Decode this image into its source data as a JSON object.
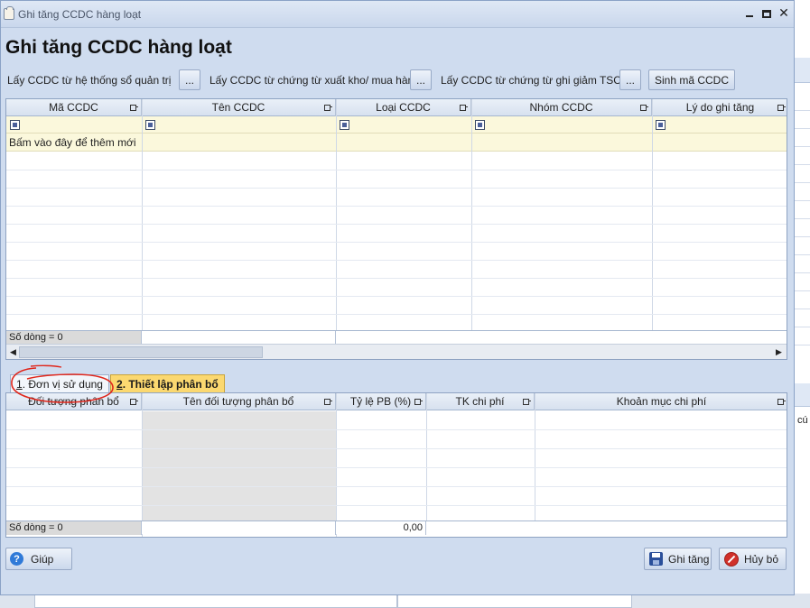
{
  "window": {
    "title": "Ghi tăng CCDC hàng loạt",
    "close_glyph": "✕"
  },
  "heading": "Ghi tăng CCDC hàng loạt",
  "toolbar": {
    "label1": "Lấy CCDC từ hệ thống sổ quản trị",
    "label2": "Lấy CCDC từ chứng từ xuất kho/ mua hàng",
    "label3": "Lấy CCDC từ chứng từ ghi giảm TSCĐ",
    "ellipsis": "...",
    "generate_code": "Sinh mã CCDC"
  },
  "top_grid": {
    "columns": [
      "Mã CCDC",
      "Tên CCDC",
      "Loại CCDC",
      "Nhóm CCDC",
      "Lý do ghi tăng"
    ],
    "new_row_text": "Bấm vào đây để thêm mới",
    "row_count": "Số dòng = 0"
  },
  "tabs": [
    {
      "num": "1",
      "label": ". Đơn vị sử dụng"
    },
    {
      "num": "2",
      "label": ". Thiết lập phân bổ"
    }
  ],
  "bottom_grid": {
    "columns": [
      "Đối tượng phân bổ",
      "Tên đối tượng phân bổ",
      "Tỷ lệ PB (%)",
      "TK chi phí",
      "Khoản mục chi phí"
    ],
    "row_count": "Số dòng = 0",
    "ratio_total": "0,00"
  },
  "buttons": {
    "help": "Giúp",
    "save": "Ghi tăng",
    "cancel": "Hủy bỏ"
  },
  "background": {
    "side_text": "cú"
  },
  "colors": {
    "active_tab": "#fbd870",
    "new_row_bg": "#fbf8dc",
    "annotation": "#e0261b"
  }
}
